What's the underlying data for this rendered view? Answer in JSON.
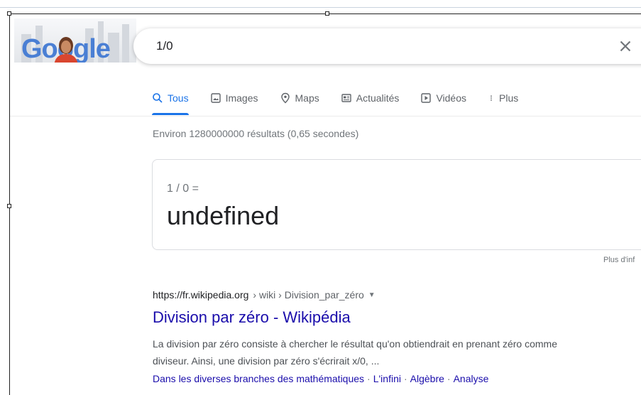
{
  "header": {
    "logo_text": "Google",
    "search_value": "1/0",
    "clear_icon": "close-icon"
  },
  "tabs": [
    {
      "label": "Tous",
      "icon": "search-icon",
      "active": true
    },
    {
      "label": "Images",
      "icon": "image-icon",
      "active": false
    },
    {
      "label": "Maps",
      "icon": "map-pin-icon",
      "active": false
    },
    {
      "label": "Actualités",
      "icon": "news-icon",
      "active": false
    },
    {
      "label": "Vidéos",
      "icon": "play-icon",
      "active": false
    },
    {
      "label": "Plus",
      "icon": "more-vert-icon",
      "active": false
    }
  ],
  "result_stats": "Environ 1280000000 résultats (0,65 secondes)",
  "calculator": {
    "expression": "1 / 0 =",
    "result": "undefined"
  },
  "more_info": "Plus d'inf",
  "result": {
    "url": "https://fr.wikipedia.org",
    "breadcrumb": "› wiki › Division_par_zéro",
    "title": "Division par zéro - Wikipédia",
    "snippet_line1": "La division par zéro consiste à chercher le résultat qu'on obtiendrait en prenant zéro comme",
    "snippet_line2": "diviseur. Ainsi, une division par zéro s'écrirait x/0, ...",
    "sitelinks": [
      "Dans les diverses branches des mathématiques",
      "L'infini",
      "Algèbre",
      "Analyse"
    ]
  },
  "colors": {
    "accent": "#1a73e8",
    "link": "#1a0dab",
    "muted": "#70757a"
  }
}
